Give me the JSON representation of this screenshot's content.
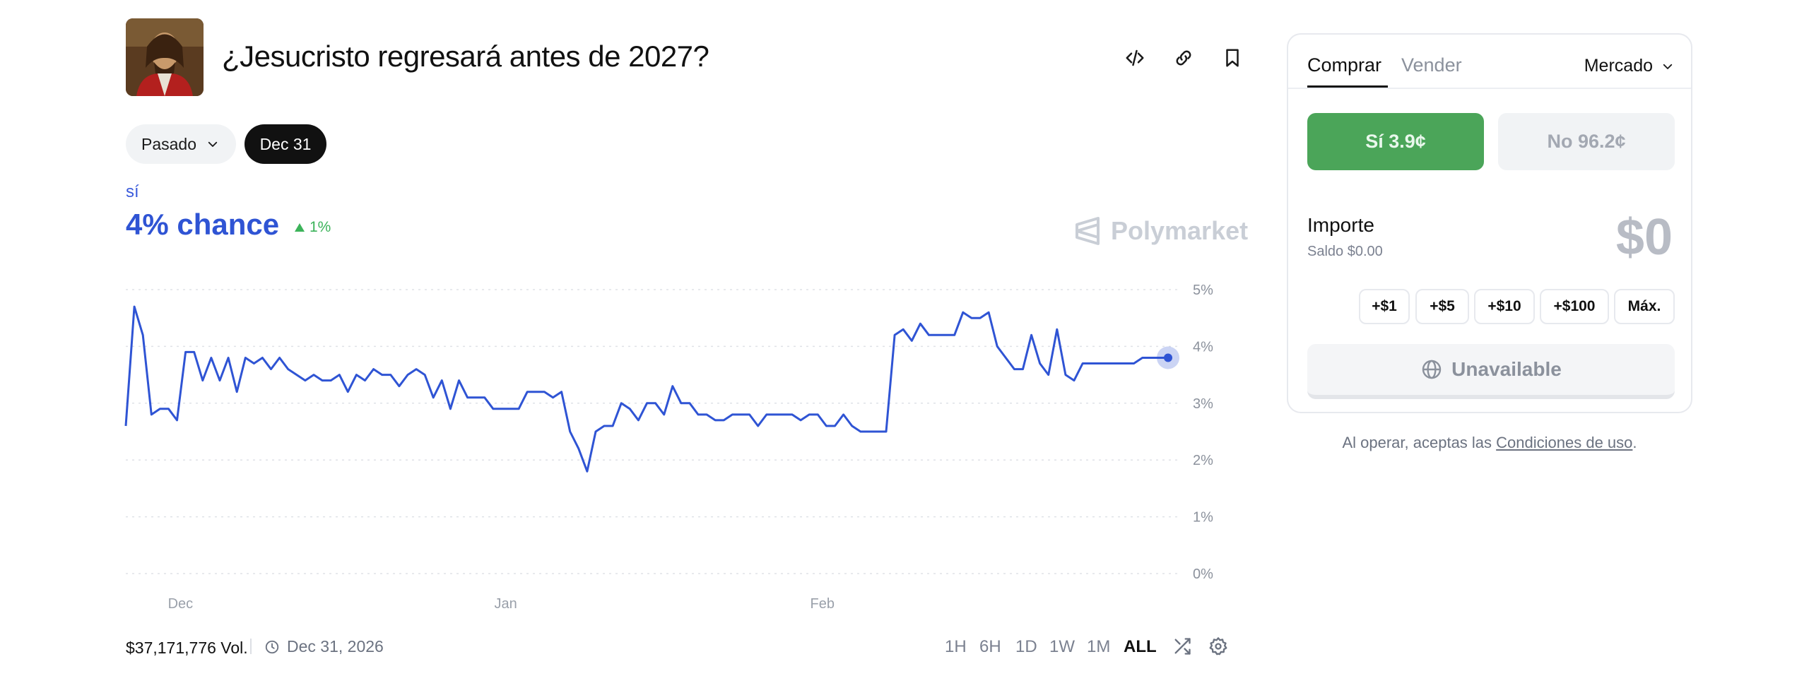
{
  "market": {
    "title": "¿Jesucristo regresará antes de 2027?",
    "image_icon": "jesus-portrait-image"
  },
  "header_actions": [
    {
      "name": "embed-code-icon"
    },
    {
      "name": "copy-link-icon"
    },
    {
      "name": "bookmark-icon"
    }
  ],
  "filters": {
    "past_label": "Pasado",
    "date_label": "Dec 31"
  },
  "outcome": {
    "name": "sí",
    "chance_text": "4% chance",
    "delta_text": "1%",
    "delta_direction": "up"
  },
  "watermark": "Polymarket",
  "footer": {
    "volume": "$37,171,776 Vol.",
    "end_date": "Dec 31, 2026",
    "ranges": [
      "1H",
      "6H",
      "1D",
      "1W",
      "1M",
      "ALL"
    ],
    "active_range": "ALL"
  },
  "trade": {
    "tab_buy": "Comprar",
    "tab_sell": "Vender",
    "order_type": "Mercado",
    "yes_label": "Sí",
    "yes_price": "3.9¢",
    "no_label": "No",
    "no_price": "96.2¢",
    "amount_label": "Importe",
    "balance": "Saldo $0.00",
    "amount_value": "$0",
    "quick_amounts": [
      "+$1",
      "+$5",
      "+$10",
      "+$100",
      "Máx."
    ],
    "unavailable_label": "Unavailable",
    "terms_prefix": "Al operar, aceptas las ",
    "terms_link": "Condiciones de uso",
    "terms_suffix": "."
  },
  "colors": {
    "line": "#2f54d4",
    "yes_button": "#4ba559",
    "up_delta": "#3cb35a"
  },
  "chart_data": {
    "type": "line",
    "title": "",
    "xlabel": "",
    "ylabel": "",
    "x_tick_labels": [
      "Dec",
      "Jan",
      "Feb"
    ],
    "y_tick_labels": [
      "5%",
      "4%",
      "3%",
      "2%",
      "1%",
      "0%"
    ],
    "ylim": [
      0,
      5
    ],
    "grid": true,
    "series": [
      {
        "values": [
          2.6,
          4.7,
          4.2,
          2.8,
          2.9,
          2.9,
          2.7,
          3.9,
          3.9,
          3.4,
          3.8,
          3.4,
          3.8,
          3.2,
          3.8,
          3.7,
          3.8,
          3.6,
          3.8,
          3.6,
          3.5,
          3.4,
          3.5,
          3.4,
          3.4,
          3.5,
          3.2,
          3.5,
          3.4,
          3.6,
          3.5,
          3.5,
          3.3,
          3.5,
          3.6,
          3.5,
          3.1,
          3.4,
          2.9,
          3.4,
          3.1,
          3.1,
          3.1,
          2.9,
          2.9,
          2.9,
          2.9,
          3.2,
          3.2,
          3.2,
          3.1,
          3.2,
          2.5,
          2.2,
          1.8,
          2.5,
          2.6,
          2.6,
          3.0,
          2.9,
          2.7,
          3.0,
          3.0,
          2.8,
          3.3,
          3.0,
          3.0,
          2.8,
          2.8,
          2.7,
          2.7,
          2.8,
          2.8,
          2.8,
          2.6,
          2.8,
          2.8,
          2.8,
          2.8,
          2.7,
          2.8,
          2.8,
          2.6,
          2.6,
          2.8,
          2.6,
          2.5,
          2.5,
          2.5,
          2.5,
          4.2,
          4.3,
          4.1,
          4.4,
          4.2,
          4.2,
          4.2,
          4.2,
          4.6,
          4.5,
          4.5,
          4.6,
          4.0,
          3.8,
          3.6,
          3.6,
          4.2,
          3.7,
          3.5,
          4.3,
          3.5,
          3.4,
          3.7,
          3.7,
          3.7,
          3.7,
          3.7,
          3.7,
          3.7,
          3.8,
          3.8,
          3.8,
          3.8
        ]
      }
    ],
    "current_value": 3.8
  }
}
